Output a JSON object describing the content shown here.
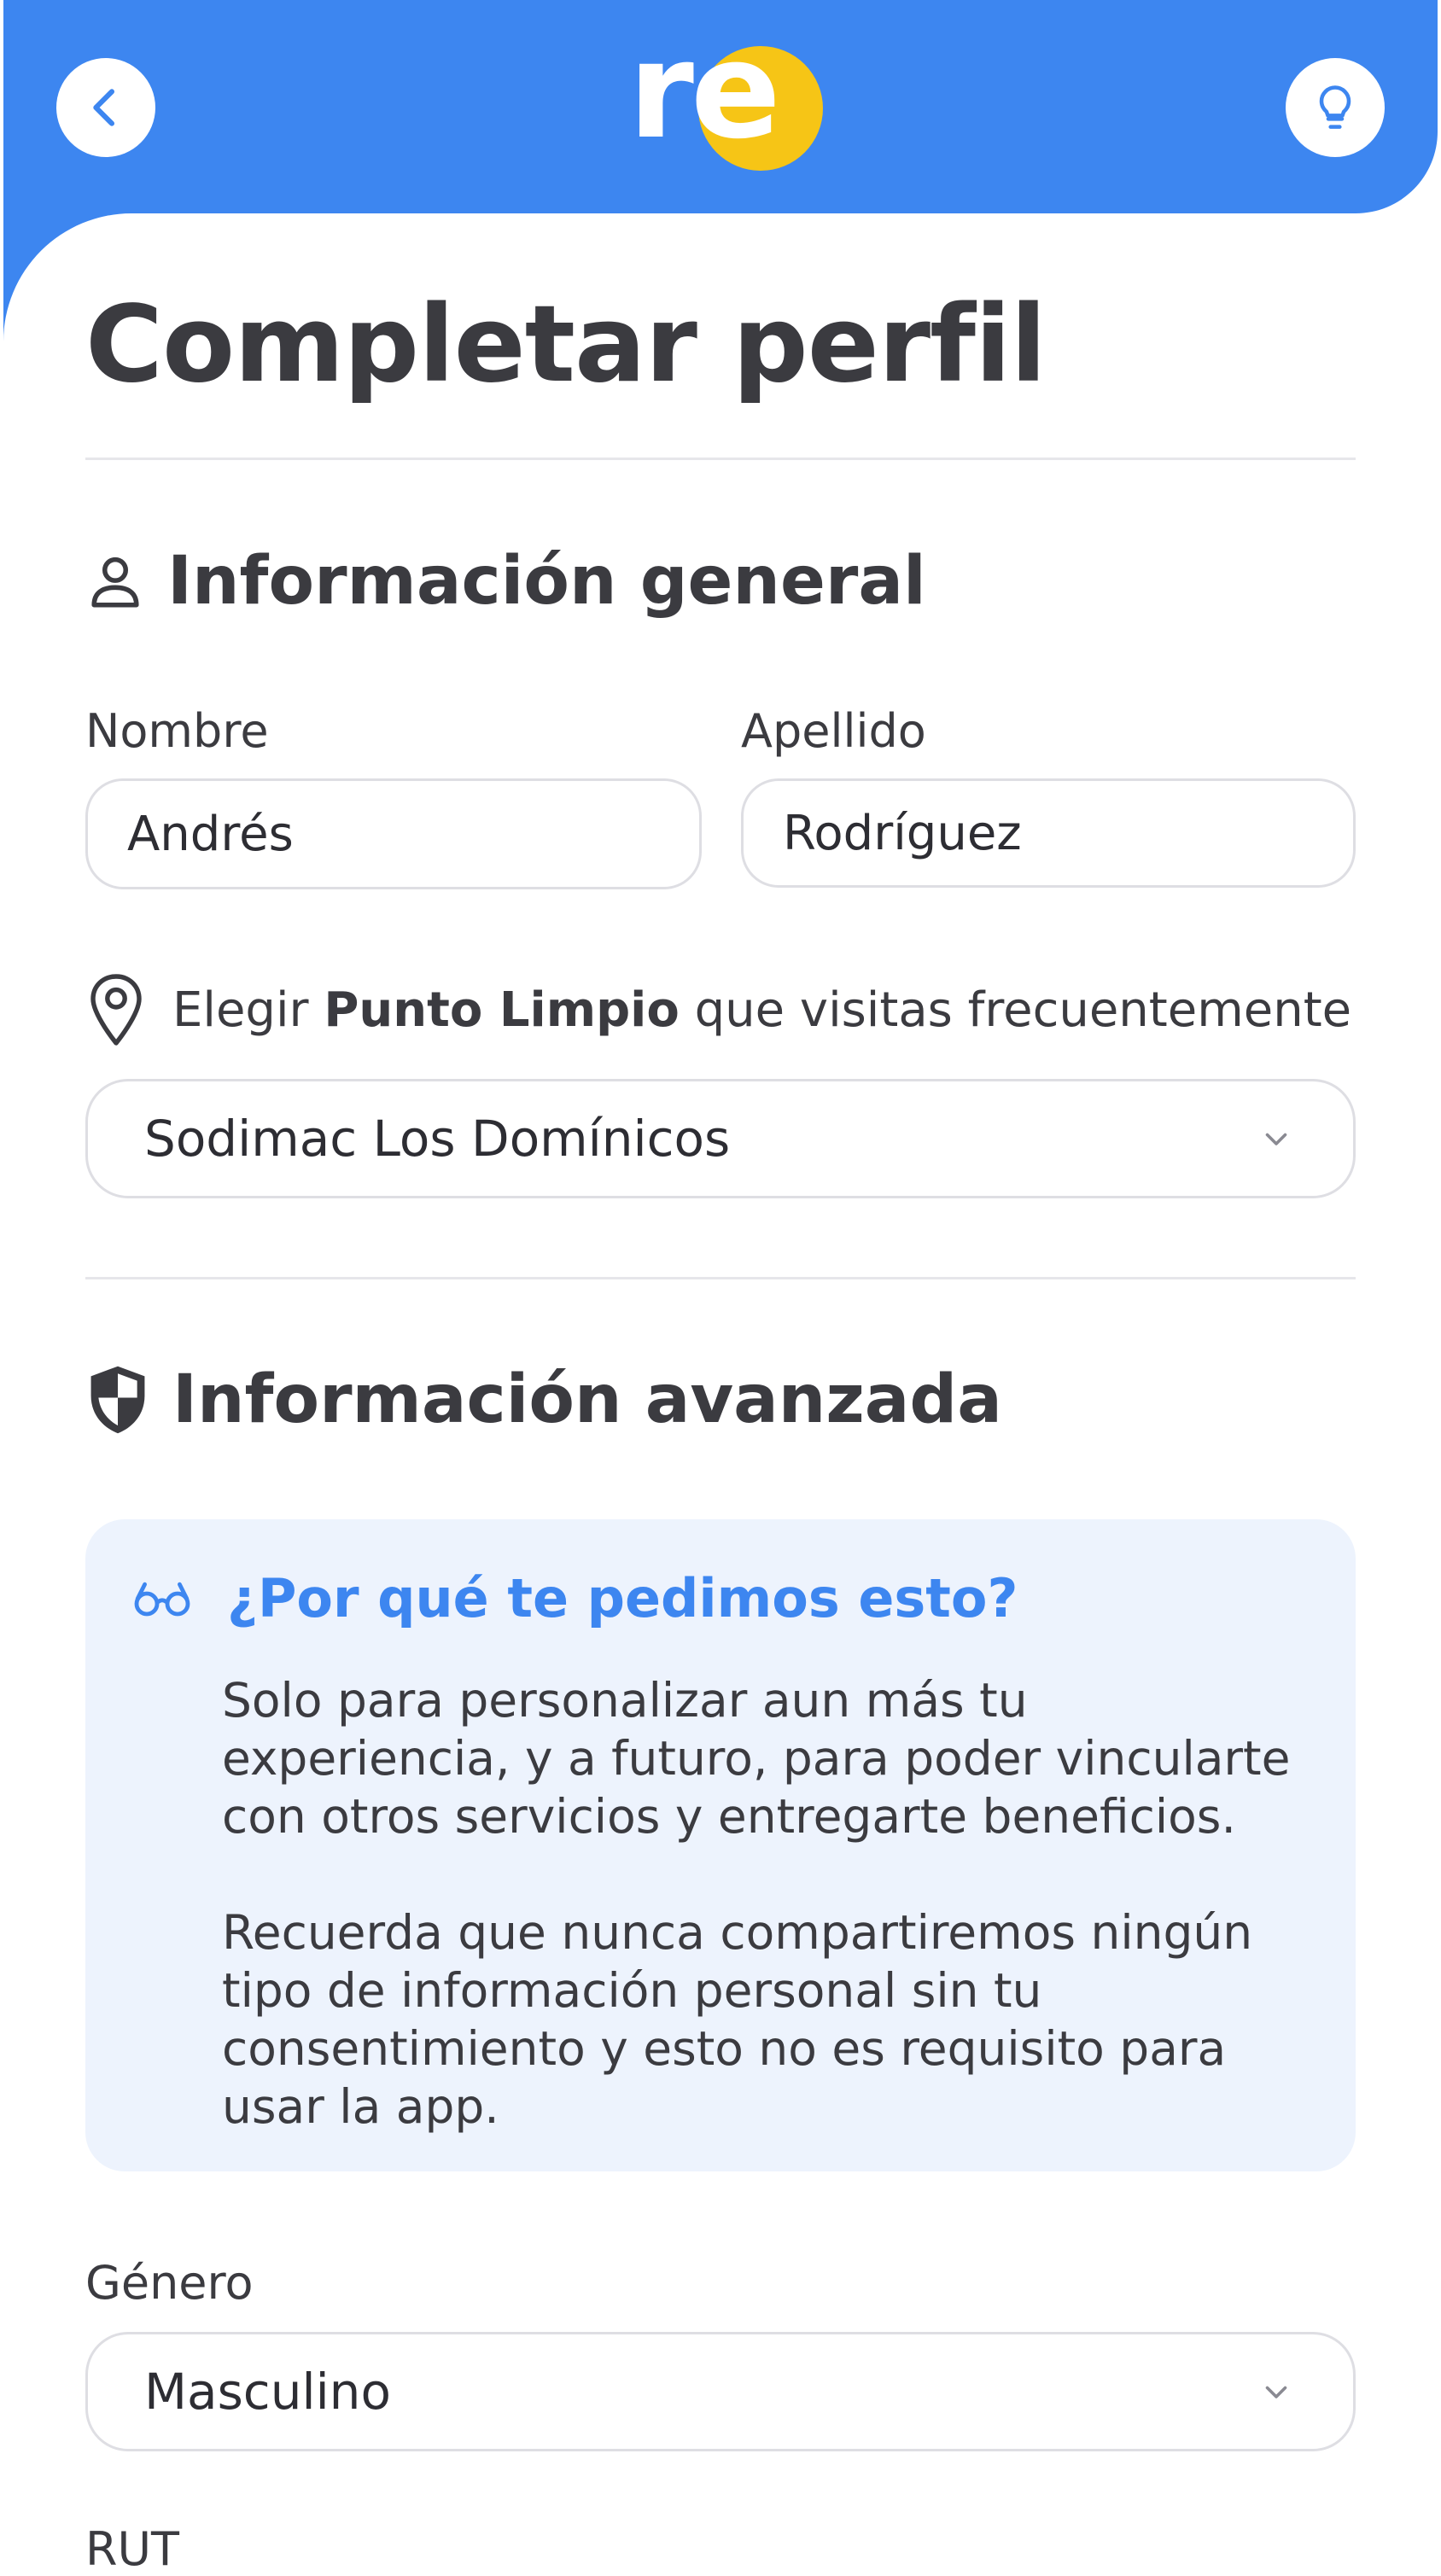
{
  "header": {
    "logo_text": "re",
    "colors": {
      "primary": "#3d86f0",
      "logo_dot": "#f6c516"
    }
  },
  "page": {
    "title": "Completar perfil"
  },
  "general": {
    "heading": "Información general",
    "first_name_label": "Nombre",
    "first_name_value": "Andrés",
    "last_name_label": "Apellido",
    "last_name_value": "Rodríguez",
    "location_prefix": "Elegir ",
    "location_bold": "Punto Limpio",
    "location_suffix": " que visitas frecuentemente",
    "location_value": "Sodimac Los Domínicos"
  },
  "advanced": {
    "heading": "Información avanzada",
    "info_title": "¿Por qué te pedimos esto?",
    "info_par1": "Solo para personalizar aun más tu experiencia, y a futuro, para poder vincularte con otros servicios y entregarte beneficios.",
    "info_par2": "Recuerda que nunca compartiremos ningún tipo de información personal sin tu consentimiento y esto no es requisito para usar la app.",
    "gender_label": "Género",
    "gender_value": "Masculino",
    "next_label": "RUT"
  },
  "icons": [
    "chevron-left-icon",
    "lightbulb-icon",
    "user-icon",
    "map-pin-icon",
    "chevron-down-icon",
    "shield-icon",
    "glasses-icon"
  ]
}
